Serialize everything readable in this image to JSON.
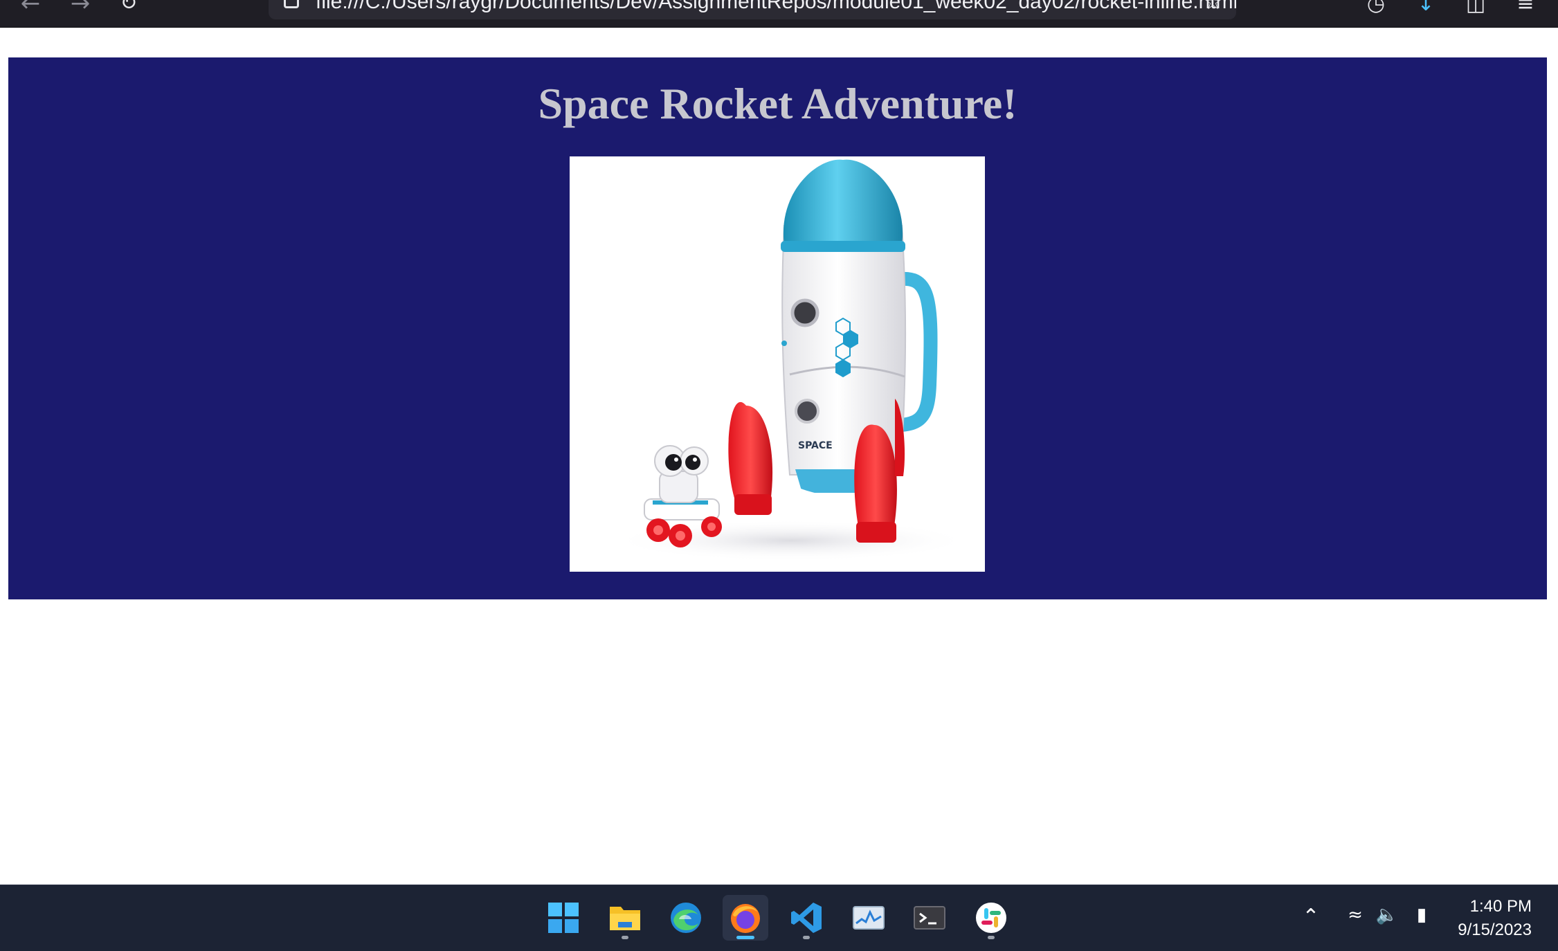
{
  "browser": {
    "url": "file:///C:/Users/raygr/Documents/Dev/AssignmentRepos/module01_week02_day02/rocket-inline.html",
    "back_icon": "arrow-left-icon",
    "forward_icon": "arrow-right-icon",
    "reload_icon": "reload-icon",
    "bookmark_icon": "star-icon"
  },
  "page": {
    "title": "Space Rocket Adventure!",
    "banner_color": "#1b1a6e",
    "image": {
      "subject": "toy rocket with astronaut rover",
      "label": "SPACE"
    }
  },
  "taskbar": {
    "apps": [
      {
        "name": "start",
        "icon": "windows-start-icon"
      },
      {
        "name": "file-explorer",
        "icon": "folder-icon"
      },
      {
        "name": "edge",
        "icon": "edge-icon"
      },
      {
        "name": "firefox",
        "icon": "firefox-icon",
        "active": true
      },
      {
        "name": "vscode",
        "icon": "vscode-icon"
      },
      {
        "name": "monitor",
        "icon": "monitor-icon"
      },
      {
        "name": "terminal",
        "icon": "terminal-icon"
      },
      {
        "name": "slack",
        "icon": "slack-icon"
      }
    ],
    "clock": {
      "time": "1:40 PM",
      "date": "9/15/2023"
    }
  }
}
